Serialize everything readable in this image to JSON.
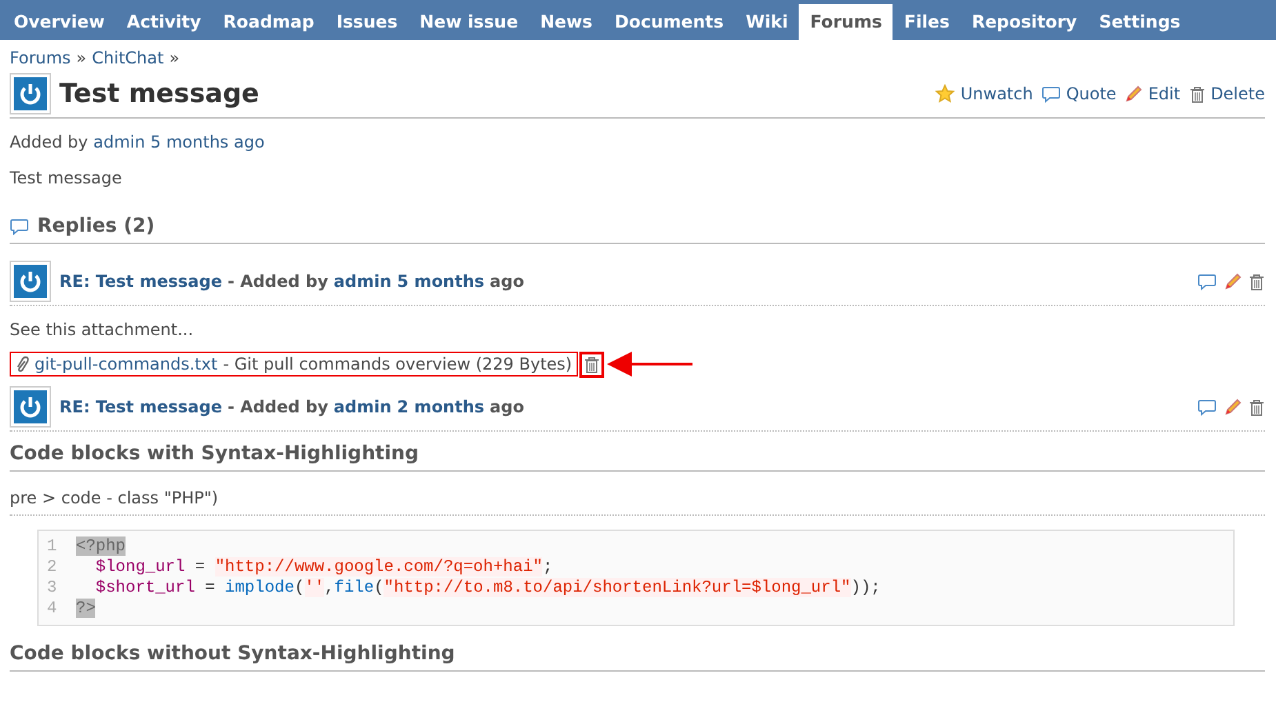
{
  "tabs": [
    {
      "label": "Overview",
      "selected": false
    },
    {
      "label": "Activity",
      "selected": false
    },
    {
      "label": "Roadmap",
      "selected": false
    },
    {
      "label": "Issues",
      "selected": false
    },
    {
      "label": "New issue",
      "selected": false
    },
    {
      "label": "News",
      "selected": false
    },
    {
      "label": "Documents",
      "selected": false
    },
    {
      "label": "Wiki",
      "selected": false
    },
    {
      "label": "Forums",
      "selected": true
    },
    {
      "label": "Files",
      "selected": false
    },
    {
      "label": "Repository",
      "selected": false
    },
    {
      "label": "Settings",
      "selected": false
    }
  ],
  "breadcrumb": [
    {
      "label": "Forums",
      "separator": "»"
    },
    {
      "label": "ChitChat",
      "separator": "»"
    }
  ],
  "message": {
    "title": "Test message",
    "actions": [
      {
        "kind": "watch",
        "label": "Unwatch"
      },
      {
        "kind": "quote",
        "label": "Quote"
      },
      {
        "kind": "edit",
        "label": "Edit"
      },
      {
        "kind": "delete",
        "label": "Delete"
      }
    ],
    "author_prefix": "Added by",
    "author": "admin",
    "age": "5 months ago",
    "body": "Test message"
  },
  "replies": {
    "heading": "Replies (2)",
    "items": [
      {
        "subject": "RE: Test message",
        "added_by": "- Added by",
        "author": "admin",
        "age": "5 months",
        "age_suffix": "ago",
        "body": "See this attachment...",
        "attachment": {
          "file": "git-pull-commands.txt",
          "description": "- Git pull commands overview (229 Bytes)"
        }
      },
      {
        "subject": "RE: Test message",
        "added_by": "- Added by",
        "author": "admin",
        "age": "2 months",
        "age_suffix": "ago"
      }
    ]
  },
  "sections": [
    {
      "kind": "heading",
      "text": "Code blocks with Syntax-Highlighting"
    },
    {
      "kind": "subheading",
      "text": "pre > code - class \"PHP\")"
    },
    {
      "kind": "code",
      "lines": [
        {
          "number": "1",
          "tokens": [
            {
              "kind": "tag",
              "text": "<?php"
            }
          ]
        },
        {
          "number": "2",
          "tokens": [
            {
              "kind": "var",
              "text": "  $long_url"
            },
            {
              "kind": "plain",
              "text": " = "
            },
            {
              "kind": "string",
              "text": "\"http://www.google.com/?q=oh+hai\""
            },
            {
              "kind": "plain",
              "text": ";"
            }
          ]
        },
        {
          "number": "3",
          "tokens": [
            {
              "kind": "var",
              "text": "  $short_url"
            },
            {
              "kind": "plain",
              "text": " = "
            },
            {
              "kind": "func",
              "text": "implode"
            },
            {
              "kind": "plain",
              "text": "("
            },
            {
              "kind": "string",
              "text": "''"
            },
            {
              "kind": "plain",
              "text": ","
            },
            {
              "kind": "func",
              "text": "file"
            },
            {
              "kind": "plain",
              "text": "("
            },
            {
              "kind": "string",
              "text": "\"http://to.m8.to/api/shortenLink?url=$long_url\""
            },
            {
              "kind": "plain",
              "text": "));"
            }
          ]
        },
        {
          "number": "4",
          "tokens": [
            {
              "kind": "tag",
              "text": "?>"
            }
          ]
        }
      ]
    },
    {
      "kind": "heading",
      "text": "Code blocks without Syntax-Highlighting"
    }
  ]
}
